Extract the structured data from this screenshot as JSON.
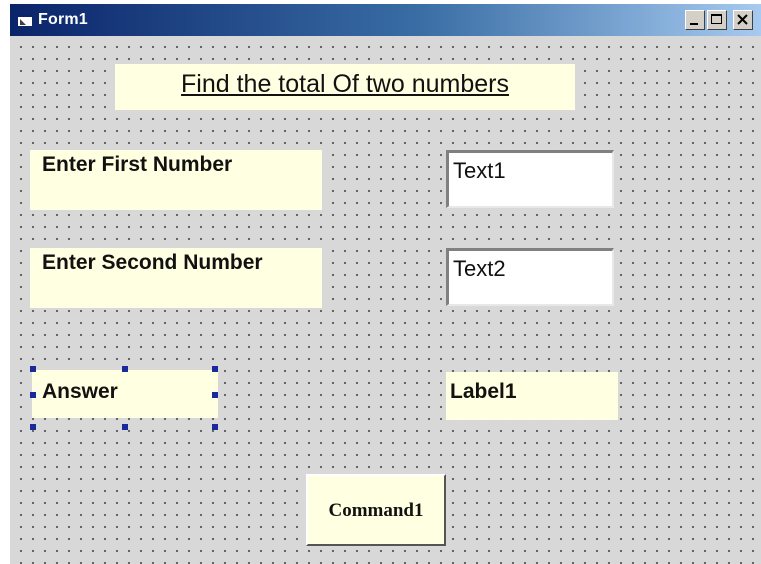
{
  "window": {
    "title": "Form1",
    "controls": [
      "minimize-icon",
      "maximize-icon",
      "close-icon"
    ]
  },
  "form": {
    "heading": "Find the total Of two numbers",
    "first_label": "Enter First Number",
    "second_label": "Enter Second Number",
    "text1_value": "Text1",
    "text2_value": "Text2",
    "answer_label": "Answer",
    "result_label": "Label1",
    "command_label": "Command1"
  },
  "colors": {
    "label_background": "#ffffe1",
    "grid_background": "#d8d8d8",
    "titlebar_start": "#0a246a",
    "selection_handle": "#1a2a9a"
  }
}
